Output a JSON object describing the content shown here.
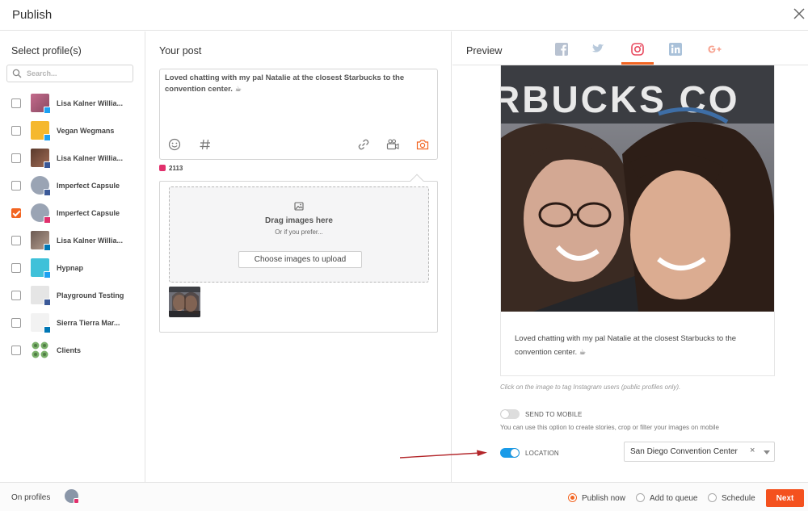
{
  "header": {
    "title": "Publish"
  },
  "profiles": {
    "title": "Select profile(s)",
    "search_placeholder": "Search...",
    "items": [
      {
        "name": "Lisa Kalner Willia...",
        "network": "twitter",
        "checked": false
      },
      {
        "name": "Vegan Wegmans",
        "network": "twitter",
        "checked": false
      },
      {
        "name": "Lisa Kalner Willia...",
        "network": "facebook",
        "checked": false
      },
      {
        "name": "Imperfect Capsule",
        "network": "facebook",
        "checked": false
      },
      {
        "name": "Imperfect Capsule",
        "network": "instagram",
        "checked": true
      },
      {
        "name": "Lisa Kalner Willia...",
        "network": "linkedin",
        "checked": false
      },
      {
        "name": "Hypnap",
        "network": "twitter",
        "checked": false
      },
      {
        "name": "Playground Testing",
        "network": "facebook",
        "checked": false
      },
      {
        "name": "Sierra Tierra Mar...",
        "network": "linkedin",
        "checked": false
      },
      {
        "name": "Clients",
        "network": "group",
        "checked": false
      }
    ]
  },
  "post": {
    "title": "Your post",
    "text": "Loved chatting with my pal Natalie at the closest Starbucks to the convention center. ☕",
    "char_count": "2113",
    "upload": {
      "drag_text": "Drag images here",
      "or_text": "Or if you prefer...",
      "choose_label": "Choose images to upload"
    }
  },
  "preview": {
    "title": "Preview",
    "tabs": [
      "facebook",
      "twitter",
      "instagram",
      "linkedin",
      "google-plus"
    ],
    "active_tab": "instagram",
    "photo_sign": "RBUCKS CO",
    "caption": "Loved chatting with my pal Natalie at the closest Starbucks to the convention center. ☕",
    "hint": "Click on the image to tag Instagram users (public profiles only).",
    "send_to_mobile_label": "SEND TO MOBILE",
    "send_to_mobile_on": false,
    "send_to_mobile_desc": "You can use this option to create stories, crop or filter your images on mobile",
    "location_label": "LOCATION",
    "location_on": true,
    "location_value": "San Diego Convention Center",
    "location_clear": "×"
  },
  "footer": {
    "on_profiles_label": "On profiles",
    "options": [
      {
        "label": "Publish now",
        "checked": true
      },
      {
        "label": "Add to queue",
        "checked": false
      },
      {
        "label": "Schedule",
        "checked": false
      }
    ],
    "next_label": "Next"
  },
  "colors": {
    "accent": "#f26522",
    "toggle_on": "#1a9be8",
    "twitter": "#1da1f2",
    "facebook": "#3b5998",
    "instagram": "#e1306c",
    "linkedin": "#0077b5"
  }
}
